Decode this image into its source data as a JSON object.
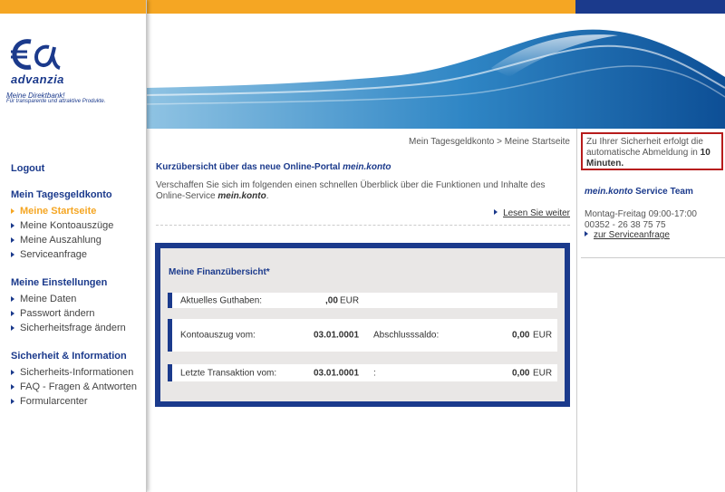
{
  "brand": {
    "logo_name": "advanzia",
    "tagline": "Meine Direktbank!",
    "subtagline": "Für transparente und attraktive Produkte."
  },
  "colors": {
    "primary": "#1b3a8c",
    "accent": "#f5a623",
    "alert": "#b71c1c"
  },
  "nav": {
    "logout": "Logout",
    "groups": [
      {
        "title": "Mein Tagesgeldkonto",
        "items": [
          {
            "label": "Meine Startseite",
            "active": true
          },
          {
            "label": "Meine Kontoauszüge"
          },
          {
            "label": "Meine Auszahlung"
          },
          {
            "label": "Serviceanfrage"
          }
        ]
      },
      {
        "title": "Meine Einstellungen",
        "items": [
          {
            "label": "Meine Daten"
          },
          {
            "label": "Passwort ändern"
          },
          {
            "label": "Sicherheitsfrage ändern"
          }
        ]
      },
      {
        "title": "Sicherheit & Information",
        "items": [
          {
            "label": "Sicherheits-Informationen"
          },
          {
            "label": "FAQ - Fragen & Antworten"
          },
          {
            "label": "Formularcenter"
          }
        ]
      }
    ]
  },
  "breadcrumb": {
    "parent": "Mein Tagesgeldkonto",
    "separator": ">",
    "current": "Meine Startseite"
  },
  "intro": {
    "title": "Kurzübersicht über das neue Online-Portal",
    "title_em": "mein.konto",
    "text": "Verschaffen Sie sich im folgenden einen schnellen Überblick über die Funktionen und Inhalte des Online-Service",
    "text_em": "mein.konto",
    "text_end": ".",
    "read_more": "Lesen Sie weiter"
  },
  "finance": {
    "title": "Meine Finanzübersicht*",
    "balance": {
      "label": "Aktuelles Guthaben:",
      "value": ",00",
      "currency": "EUR"
    },
    "statement": {
      "label": "Kontoauszug vom:",
      "date": "03.01.0001",
      "closing_label": "Abschlusssaldo:",
      "closing_value": "0,00",
      "currency": "EUR"
    },
    "last_transaction": {
      "label": "Letzte Transaktion vom:",
      "date": "03.01.0001",
      "sep": ":",
      "value": "0,00",
      "currency": "EUR"
    }
  },
  "security_notice": {
    "text": "Zu Ihrer Sicherheit erfolgt die automatische Abmeldung in",
    "time": "10 Minuten."
  },
  "service": {
    "title_em": "mein.konto",
    "title": "Service Team",
    "hours": "Montag-Freitag 09:00-17:00",
    "phone": "00352 - 26 38 75 75",
    "link": "zur Serviceanfrage"
  }
}
